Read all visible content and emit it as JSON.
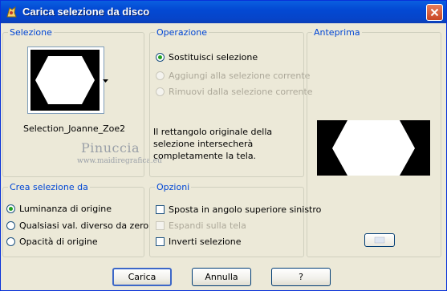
{
  "window": {
    "title": "Carica selezione da disco"
  },
  "selezione": {
    "legend": "Selezione",
    "thumbnail_name": "Selection_Joanne_Zoe2",
    "watermark_name": "Pinuccia",
    "watermark_url": "www.maidiregrafica.eu"
  },
  "operazione": {
    "legend": "Operazione",
    "options": [
      {
        "label": "Sostituisci selezione",
        "checked": true,
        "disabled": false
      },
      {
        "label": "Aggiungi alla selezione corrente",
        "checked": false,
        "disabled": true
      },
      {
        "label": "Rimuovi dalla selezione corrente",
        "checked": false,
        "disabled": true
      }
    ],
    "description": "Il rettangolo originale della selezione intersecherà completamente la tela."
  },
  "anteprima": {
    "legend": "Anteprima"
  },
  "crea": {
    "legend": "Crea selezione da",
    "options": [
      {
        "label": "Luminanza di origine",
        "checked": true
      },
      {
        "label": "Qualsiasi val. diverso da zero",
        "checked": false
      },
      {
        "label": "Opacità di origine",
        "checked": false
      }
    ]
  },
  "opzioni": {
    "legend": "Opzioni",
    "options": [
      {
        "label": "Sposta in angolo superiore sinistro",
        "checked": false,
        "disabled": false
      },
      {
        "label": "Espandi sulla tela",
        "checked": false,
        "disabled": true
      },
      {
        "label": "Inverti selezione",
        "checked": false,
        "disabled": false
      }
    ]
  },
  "buttons": {
    "load": "Carica",
    "cancel": "Annulla",
    "help": "?"
  },
  "colors": {
    "titlebar": "#0349d3",
    "legend": "#0046d5",
    "dialog_bg": "#ece9d8",
    "radio_dot": "#21a121",
    "close": "#c94524"
  }
}
